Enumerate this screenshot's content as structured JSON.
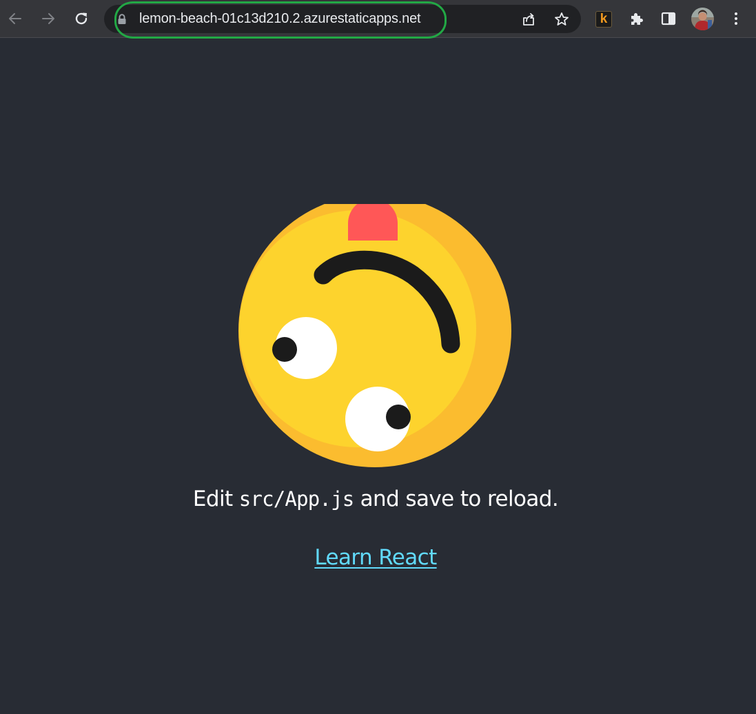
{
  "browser": {
    "url": "lemon-beach-01c13d210.2.azurestaticapps.net",
    "extension_badge": "k",
    "icons": {
      "back": "arrow-left-icon",
      "forward": "arrow-right-icon",
      "reload": "reload-icon",
      "lock": "lock-icon",
      "share": "share-icon",
      "bookmark": "star-icon",
      "extensions": "puzzle-icon",
      "side_panel": "side-panel-icon",
      "menu": "kebab-menu-icon"
    },
    "highlight_color": "#22a845"
  },
  "page": {
    "edit_prefix": "Edit ",
    "edit_code": "src/App.js",
    "edit_suffix": " and save to reload.",
    "link_label": "Learn React",
    "colors": {
      "background": "#282c34",
      "text": "#ffffff",
      "link": "#61dafb",
      "face": "#fdd32d",
      "face_shade": "#fbbc2f",
      "tongue": "#ff5757",
      "eye_white": "#ffffff",
      "pupil": "#1b1b1b"
    }
  }
}
